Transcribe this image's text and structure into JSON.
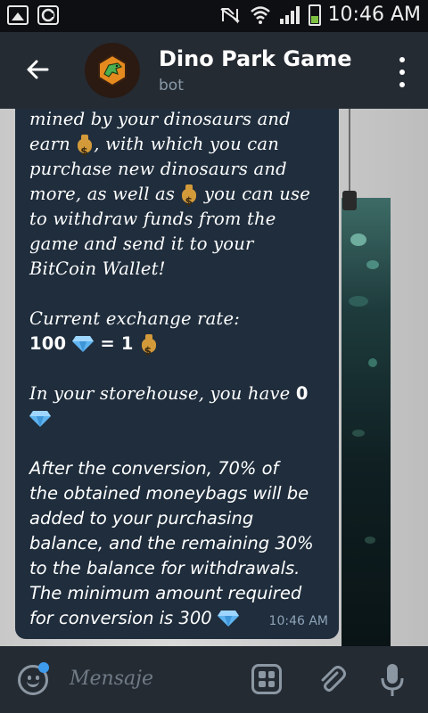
{
  "status_bar": {
    "time": "10:46 AM",
    "icons": [
      "image-icon",
      "app-icon",
      "mute-icon",
      "wifi-icon",
      "signal-icon",
      "battery-icon"
    ]
  },
  "header": {
    "title": "Dino Park Game",
    "subtitle": "bot",
    "avatar_icon": "dino-logo-icon",
    "back_icon": "arrow-left-icon",
    "menu_icon": "more-vertical-icon"
  },
  "message": {
    "line1": "mined by your dinosaurs and",
    "line2_a": "earn",
    "line2_b": ", with which you can",
    "line3": "purchase new dinosaurs and",
    "line4_a": "more, as well as",
    "line4_b": "you can use",
    "line5": "to withdraw funds from the",
    "line6": "game and send it to your",
    "line7": "BitCoin Wallet!",
    "rate_label": "Current exchange rate:",
    "rate_left": "100",
    "rate_mid": "= 1",
    "storehouse_text": "In your storehouse, you have",
    "storehouse_value": "0",
    "conversion_text": "After the conversion, 70% of\nthe obtained moneybags will be\nadded to your purchasing\nbalance, and the remaining 30%\nto the balance for withdrawals.\nThe minimum amount required\nfor conversion is 300",
    "time": "10:46 AM"
  },
  "input": {
    "placeholder": "Mensaje",
    "icons": [
      "emoji-icon",
      "bot-commands-icon",
      "attach-icon",
      "microphone-icon"
    ]
  },
  "colors": {
    "header_bg": "#252b33",
    "bubble_bg": "#1f2d3c",
    "accent_blue": "#3f9bec",
    "gem_blue": "#5fb4ef",
    "bag_gold": "#d39a3a"
  }
}
